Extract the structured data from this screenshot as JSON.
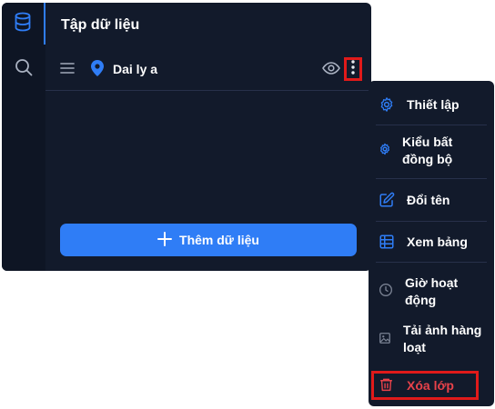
{
  "panel": {
    "title": "Tập dữ liệu",
    "layer": {
      "name": "Dai ly a"
    },
    "add_button_label": "Thêm dữ liệu"
  },
  "rail": {
    "items": [
      {
        "icon": "database-icon",
        "active": true
      },
      {
        "icon": "search-icon",
        "active": false
      }
    ]
  },
  "menu": {
    "items": [
      {
        "label": "Thiết lập",
        "icon": "gear-icon"
      },
      {
        "label": "Kiểu bất đồng bộ",
        "icon": "gear-small-icon"
      },
      {
        "label": "Đổi tên",
        "icon": "edit-icon"
      },
      {
        "label": "Xem bảng",
        "icon": "table-icon"
      },
      {
        "label": "Giờ hoạt động",
        "icon": "clock-icon",
        "disabled": true
      },
      {
        "label": "Tải ảnh hàng loạt",
        "icon": "image-icon",
        "disabled": true
      },
      {
        "label": "Xóa lớp",
        "icon": "trash-icon",
        "danger": true
      }
    ]
  },
  "colors": {
    "accent": "#2f7df6",
    "danger": "#e8424a",
    "highlight": "#e01a1a",
    "panel_bg": "#121a2b"
  }
}
